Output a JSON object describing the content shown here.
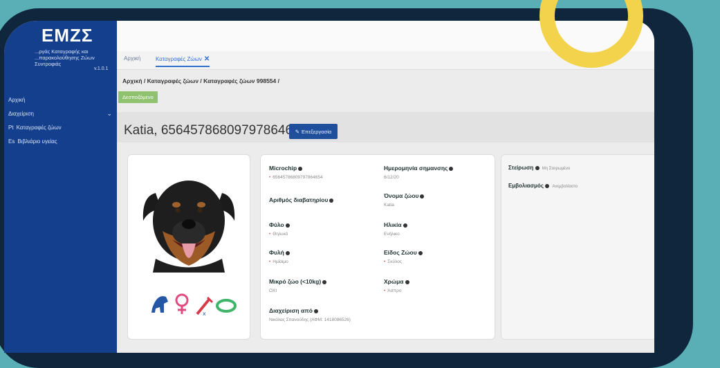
{
  "app": {
    "logo": "ΕΜΖΣ",
    "subtitle": "...ργάς Καταγραφής και ...παρακολούθησης Ζώων Συντροφιάς",
    "version": "v.1.0.1"
  },
  "sidebar": {
    "items": [
      {
        "label": "Αρχική",
        "icon": ""
      },
      {
        "label": "Διαχείριση",
        "icon": ""
      },
      {
        "label": "Καταγραφές ζώων",
        "icon": "Pt"
      },
      {
        "label": "Βιβλιάριο υγείας",
        "icon": "Εs"
      }
    ]
  },
  "tabs": [
    {
      "label": "Αρχική"
    },
    {
      "label": "Καταγραφές Ζώων"
    }
  ],
  "breadcrumb": "Αρχική / Καταγραφές ζώων / Καταγραφές ζώων 998554 /",
  "status_label": "Δεσποζόμενο",
  "pet": {
    "title": "Katia, 65645786809797864654",
    "edit_label": "Επεξεργασία"
  },
  "info": {
    "microchip": {
      "label": "Microchip",
      "value": "65645786809797864654"
    },
    "marking_date": {
      "label": "Ημερομηνία σημανσης",
      "value": "6/12/20"
    },
    "passport": {
      "label": "Αριθμός διαβατηρίου"
    },
    "animal_name": {
      "label": "Όνομα ζώου",
      "value": "Katia"
    },
    "sex": {
      "label": "Φύλο",
      "value": "Θηλυκό"
    },
    "age": {
      "label": "Ηλικία",
      "value": "Ενήλικο"
    },
    "breed": {
      "label": "Φυλή",
      "value": "Ημίαιμο"
    },
    "species": {
      "label": "Είδος Ζώου",
      "value": "Σκύλος"
    },
    "small": {
      "label": "Μικρό ζώο (<10kg)",
      "value": "ΟΧΙ"
    },
    "color": {
      "label": "Χρώμα",
      "value": "Άσπρο"
    },
    "managed_by": {
      "label": "Διαχείριση από",
      "value": "Νικόλας Σπανούδης (ΑΦΜ: 1418086526)"
    }
  },
  "side": {
    "sterilization": {
      "label": "Στείρωση",
      "value": "Μη Στειρωμένο"
    },
    "vaccination": {
      "label": "Εμβολιασμός",
      "value": "Ανεμβολίαστο"
    }
  },
  "icons": [
    "dog-icon",
    "female-icon",
    "vaccine-icon",
    "collar-icon"
  ],
  "colors": {
    "sidebar": "#143f8c",
    "accent": "#2f6fcf",
    "status": "#8fc16e",
    "frame": "#10263d",
    "background": "#5aaeb6",
    "ring": "#f3d24c"
  }
}
